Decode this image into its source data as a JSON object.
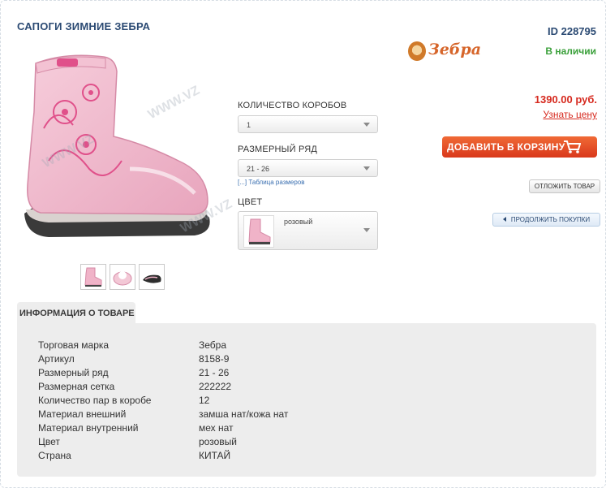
{
  "product": {
    "title": "САПОГИ ЗИМНИЕ ЗЕБРА",
    "id_label": "ID 228795",
    "availability": "В наличии",
    "brand_logo_text": "Зебра",
    "watermark": "WWW.VZ"
  },
  "options": {
    "boxes_label": "КОЛИЧЕСТВО КОРОБОВ",
    "boxes_value": "1",
    "size_label": "РАЗМЕРНЫЙ РЯД",
    "size_value": "21 - 26",
    "size_chart_link": "[...] Таблица размеров",
    "color_label": "ЦВЕТ",
    "color_value": "розовый"
  },
  "purchase": {
    "price": "1390.00 руб.",
    "price_link": "Узнать цену",
    "add_to_cart": "ДОБАВИТЬ В КОРЗИНУ",
    "postpone": "ОТЛОЖИТЬ ТОВАР",
    "continue": "ПРОДОЛЖИТЬ ПОКУПКИ"
  },
  "info": {
    "tab_label": "ИНФОРМАЦИЯ О ТОВАРЕ",
    "rows": [
      {
        "key": "Торговая марка",
        "value": "Зебра"
      },
      {
        "key": "Артикул",
        "value": "8158-9"
      },
      {
        "key": "Размерный ряд",
        "value": "21 - 26"
      },
      {
        "key": "Размерная сетка",
        "value": "222222"
      },
      {
        "key": "Количество пар в коробе",
        "value": "12"
      },
      {
        "key": "Материал внешний",
        "value": "замша нат/кожа нат"
      },
      {
        "key": "Материал внутренний",
        "value": "мех нат"
      },
      {
        "key": "Цвет",
        "value": "розовый"
      },
      {
        "key": "Страна",
        "value": "КИТАЙ"
      }
    ]
  },
  "colors": {
    "title_blue": "#2b4a73",
    "in_stock_green": "#3aa03a",
    "price_red": "#d62a1f",
    "cart_orange": "#e4502a",
    "boot_pink": "#f2b8cc"
  },
  "icons": [
    "cart-icon",
    "chevron-down-icon",
    "chevron-left-icon",
    "brand-logo-icon"
  ]
}
